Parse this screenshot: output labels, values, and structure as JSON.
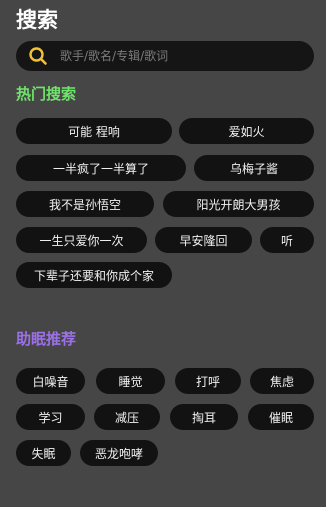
{
  "header": {
    "title": "搜索"
  },
  "search": {
    "placeholder": "歌手/歌名/专辑/歌词"
  },
  "hot": {
    "title": "热门搜索",
    "items": [
      "可能 程响",
      "爱如火",
      "一半疯了一半算了",
      "乌梅子酱",
      "我不是孙悟空",
      "阳光开朗大男孩",
      "一生只爱你一次",
      "早安隆回",
      "听",
      "下辈子还要和你成个家"
    ]
  },
  "sleep": {
    "title": "助眠推荐",
    "items": [
      "白噪音",
      "睡觉",
      "打呼",
      "焦虑",
      "学习",
      "减压",
      "掏耳",
      "催眠",
      "失眠",
      "恶龙咆哮"
    ]
  },
  "colors": {
    "background": "#464646",
    "chip": "#121212",
    "hot_title": "#6fe36a",
    "sleep_title": "#9b70e8",
    "search_icon": "#f2c230"
  },
  "icons": {
    "search": "search-icon"
  }
}
